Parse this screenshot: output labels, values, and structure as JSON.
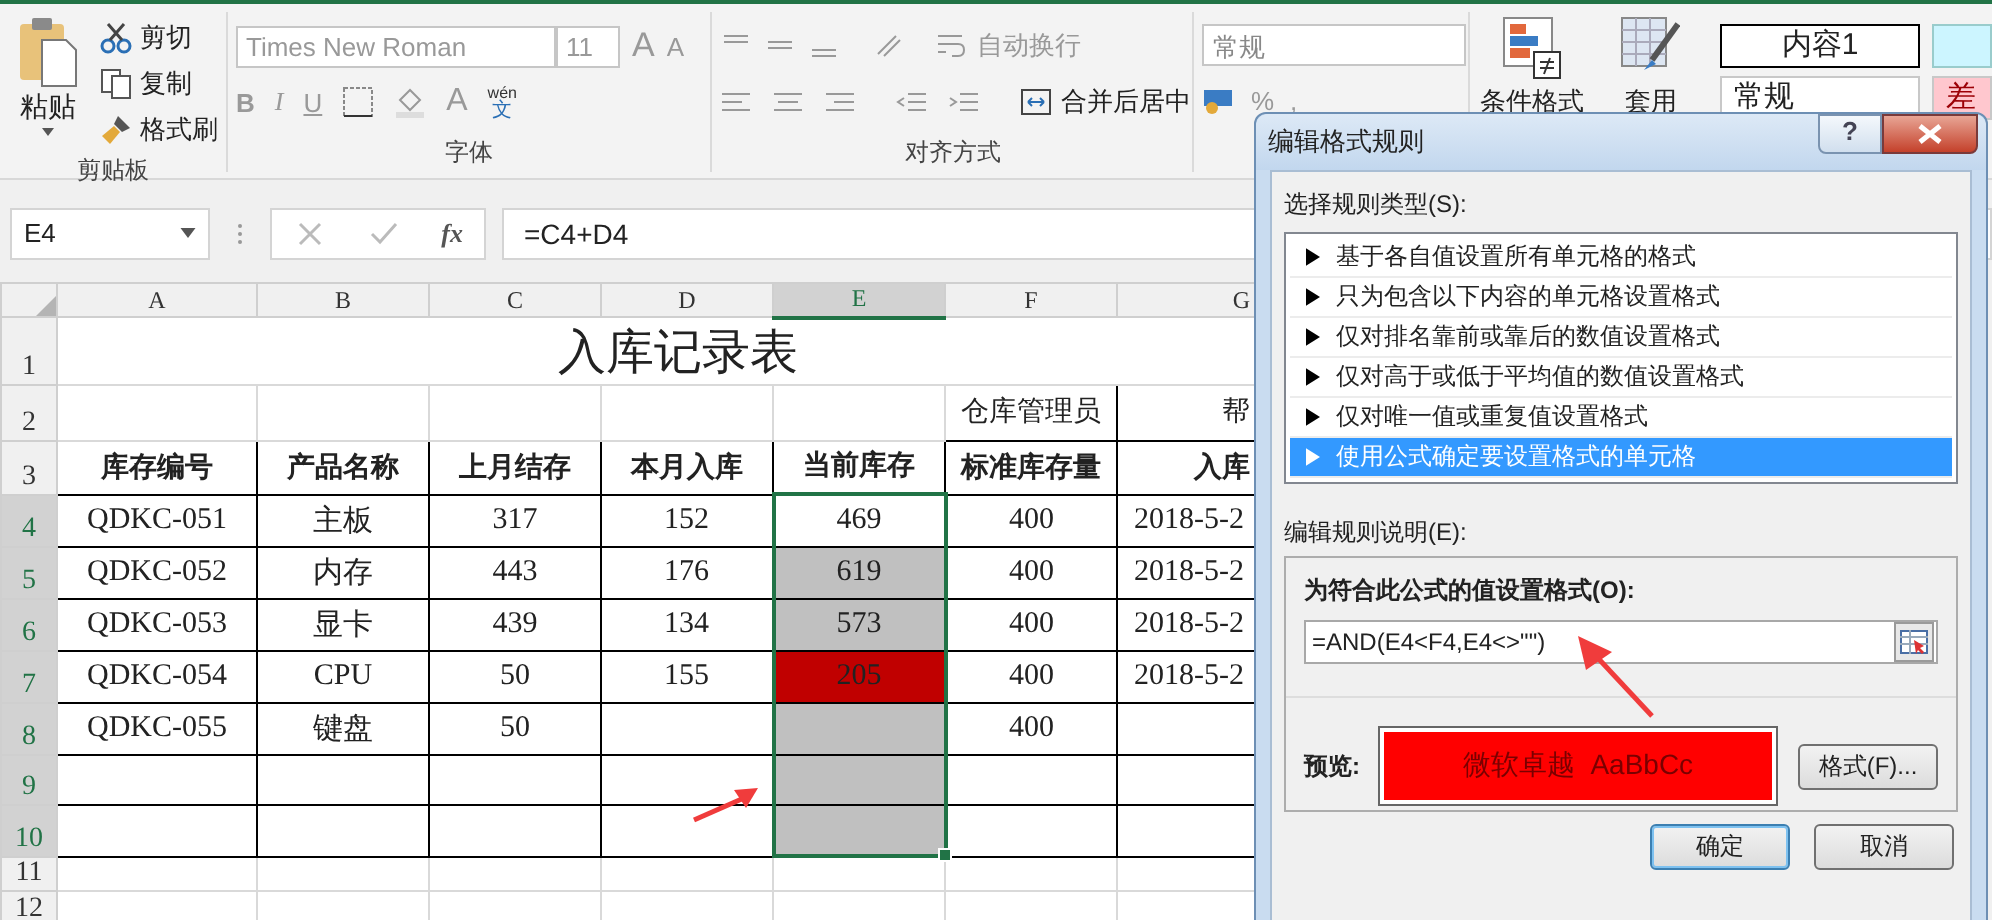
{
  "ribbon": {
    "clipboard": {
      "paste": "粘贴",
      "cut": "剪切",
      "copy": "复制",
      "format_painter": "格式刷",
      "label": "剪贴板"
    },
    "font": {
      "font_name": "Times New Roman",
      "font_size": "11",
      "grow": "A",
      "shrink": "A",
      "bold": "B",
      "italic": "I",
      "underline": "U",
      "font_color": "A",
      "phonetic_top": "wén",
      "phonetic_bottom": "文",
      "label": "字体"
    },
    "alignment": {
      "wrap_text": "自动换行",
      "merge_center": "合并后居中",
      "label": "对齐方式"
    },
    "number": {
      "format": "常规",
      "percent": "%",
      "comma": ","
    },
    "conditional_formatting": "条件格式",
    "format_as_table": "套用",
    "styles": [
      {
        "label": "内容1",
        "color": "#ffffff"
      },
      {
        "label": "常规",
        "color": "#ffffff"
      },
      {
        "label": "差",
        "color": "#ffc7ce"
      }
    ]
  },
  "formula_bar": {
    "name_box": "E4",
    "insert_function": "fx",
    "formula": "=C4+D4"
  },
  "sheet": {
    "columns": [
      {
        "label": "A",
        "selected": false
      },
      {
        "label": "B",
        "selected": false
      },
      {
        "label": "C",
        "selected": false
      },
      {
        "label": "D",
        "selected": false
      },
      {
        "label": "E",
        "selected": true
      },
      {
        "label": "F",
        "selected": false
      },
      {
        "label": "G",
        "selected": false
      }
    ],
    "row_headers": [
      {
        "label": "1",
        "selected": false
      },
      {
        "label": "2",
        "selected": false
      },
      {
        "label": "3",
        "selected": false
      },
      {
        "label": "4",
        "selected": true
      },
      {
        "label": "5",
        "selected": true
      },
      {
        "label": "6",
        "selected": true
      },
      {
        "label": "7",
        "selected": true
      },
      {
        "label": "8",
        "selected": true
      },
      {
        "label": "9",
        "selected": true
      },
      {
        "label": "10",
        "selected": true
      },
      {
        "label": "11",
        "selected": false
      },
      {
        "label": "12",
        "selected": false
      }
    ],
    "title": "入库记录表",
    "row2": {
      "f": "仓库管理员",
      "g": "帮"
    },
    "header": [
      "库存编号",
      "产品名称",
      "上月结存",
      "本月入库",
      "当前库存",
      "标准库存量",
      "入库"
    ],
    "data": [
      {
        "a": "QDKC-051",
        "b": "主板",
        "c": "317",
        "d": "152",
        "e": "469",
        "f": "400",
        "g": "2018-5-2"
      },
      {
        "a": "QDKC-052",
        "b": "内存",
        "c": "443",
        "d": "176",
        "e": "619",
        "f": "400",
        "g": "2018-5-2",
        "color": "#c0c0c0"
      },
      {
        "a": "QDKC-053",
        "b": "显卡",
        "c": "439",
        "d": "134",
        "e": "573",
        "f": "400",
        "g": "2018-5-2",
        "color": "#c0c0c0"
      },
      {
        "a": "QDKC-054",
        "b": "CPU",
        "c": "50",
        "d": "155",
        "e": "205",
        "f": "400",
        "g": "2018-5-2",
        "color": "#c00000"
      },
      {
        "a": "QDKC-055",
        "b": "键盘",
        "c": "50",
        "f": "400",
        "color": "#c0c0c0"
      },
      {
        "color": "#c0c0c0"
      },
      {
        "color": "#c0c0c0"
      }
    ]
  },
  "dialog": {
    "title": "编辑格式规则",
    "help_button": "?",
    "rule_type_label": "选择规则类型(S):",
    "rule_types": [
      {
        "label": "基于各自值设置所有单元格的格式",
        "selected": false
      },
      {
        "label": "只为包含以下内容的单元格设置格式",
        "selected": false
      },
      {
        "label": "仅对排名靠前或靠后的数值设置格式",
        "selected": false
      },
      {
        "label": "仅对高于或低于平均值的数值设置格式",
        "selected": false
      },
      {
        "label": "仅对唯一值或重复值设置格式",
        "selected": false
      },
      {
        "label": "使用公式确定要设置格式的单元格",
        "selected": true
      }
    ],
    "description_label": "编辑规则说明(E):",
    "formula_label": "为符合此公式的值设置格式(O):",
    "formula": "=AND(E4<F4,E4<>\"\")",
    "preview_label": "预览:",
    "preview_text": "微软卓越  AaBbCc",
    "format_button": "格式(F)...",
    "ok_button": "确定",
    "cancel_button": "取消"
  }
}
